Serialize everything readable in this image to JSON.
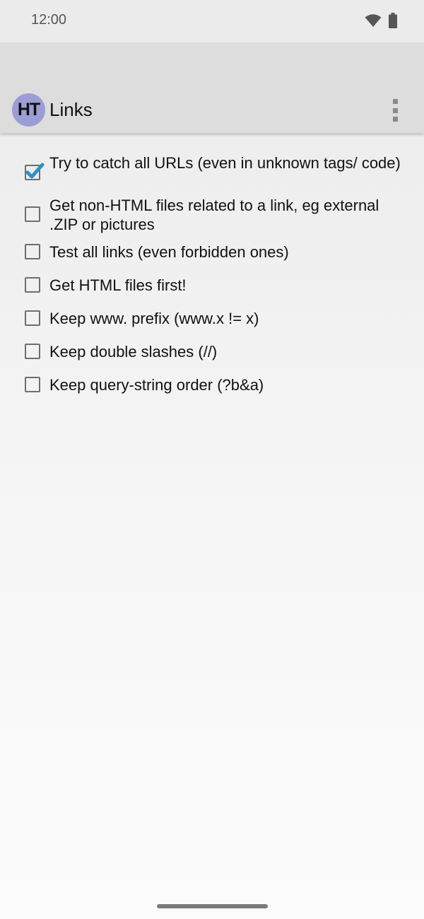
{
  "status_bar": {
    "time": "12:00",
    "icons": [
      "wifi-icon",
      "battery-icon"
    ]
  },
  "app_bar": {
    "logo_text": "HT",
    "title": "Links",
    "menu_icon": "more-vert-icon"
  },
  "options": [
    {
      "label": "Try to catch all URLs (even in unknown tags/ code)",
      "checked": true
    },
    {
      "label": "Get non-HTML files related to a link, eg external .ZIP or pictures",
      "checked": false
    },
    {
      "label": "Test all links (even forbidden ones)",
      "checked": false
    },
    {
      "label": "Get HTML files first!",
      "checked": false
    },
    {
      "label": "Keep www. prefix (www.x != x)",
      "checked": false
    },
    {
      "label": "Keep double slashes (//)",
      "checked": false
    },
    {
      "label": "Keep query-string order (?b&a)",
      "checked": false
    }
  ],
  "colors": {
    "accent": "#2f8fc7",
    "logo_bg": "#9d9dd6",
    "app_bar_bg": "#dddddd"
  }
}
